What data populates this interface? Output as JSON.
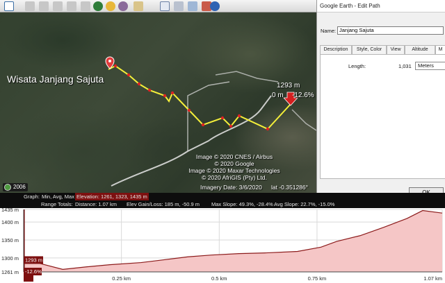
{
  "toolbar": {
    "buttons": [
      "sidebar-icon",
      "placemark-icon",
      "polygon-icon",
      "path-icon",
      "overlay-icon",
      "record-tour-icon",
      "historical-imagery-icon",
      "sun-icon",
      "planets-icon",
      "ruler-icon",
      "email-icon",
      "print-icon",
      "save-image-icon",
      "maps-icon",
      "earth-icon"
    ]
  },
  "map": {
    "place_label": "Wisata Janjang Sajuta",
    "cursor_elevation": "1293 m",
    "cursor_distance": "0 m",
    "cursor_slope": "-12.6%",
    "credits": [
      "Image © 2020 CNES / Airbus",
      "© 2020 Google",
      "Image © 2020 Maxar Technologies",
      "© 2020 AfriGIS (Pty) Ltd."
    ],
    "imagery_date": "Imagery Date: 3/6/2020",
    "lat": "lat   -0.351286°",
    "year": "2006"
  },
  "dialog": {
    "title": "Google Earth - Edit Path",
    "name_label": "Name:",
    "name_value": "Janjang Sajuta",
    "tabs": [
      "Description",
      "Style, Color",
      "View",
      "Altitude",
      "M"
    ],
    "length_label": "Length:",
    "length_value": "1,031",
    "units_value": "Meters",
    "ok_label": "OK"
  },
  "stats": {
    "graph_label": "Graph:",
    "graph_minavgmax": "Min, Avg, Max",
    "elevation": "Elevation: 1261, 1323, 1435 m",
    "range_totals": "Range Totals:",
    "distance": "Distance: 1.07 km",
    "elev_gain_loss": "Elev Gain/Loss: 185 m, -50.9 m",
    "max_slope": "Max Slope: 49.3%, -28.4%",
    "avg_slope": "Avg Slope: 22.7%, -15.0%"
  },
  "profile": {
    "y_ticks": [
      "1435 m",
      "1400 m",
      "1350 m",
      "1300 m",
      "1261 m"
    ],
    "x_ticks": [
      "0 m",
      "0.25 km",
      "0.5 km",
      "0.75 km",
      "1.07 km"
    ],
    "marker_elevation": "1293 m",
    "marker_slope": "-12.6%"
  },
  "chart_data": {
    "type": "area",
    "x": [
      0,
      0.04,
      0.1,
      0.16,
      0.22,
      0.3,
      0.36,
      0.42,
      0.48,
      0.55,
      0.62,
      0.7,
      0.76,
      0.8,
      0.86,
      0.92,
      0.98,
      1.02,
      1.07
    ],
    "values": [
      1293,
      1285,
      1268,
      1275,
      1281,
      1287,
      1295,
      1303,
      1308,
      1312,
      1314,
      1318,
      1330,
      1346,
      1362,
      1385,
      1410,
      1432,
      1425
    ],
    "xlabel": "",
    "ylabel": "",
    "xlim": [
      0,
      1.07
    ],
    "ylim": [
      1261,
      1435
    ],
    "x_unit": "km",
    "y_unit": "m",
    "fill_color": "#f5c6c6",
    "line_color": "#8b1a1a"
  }
}
